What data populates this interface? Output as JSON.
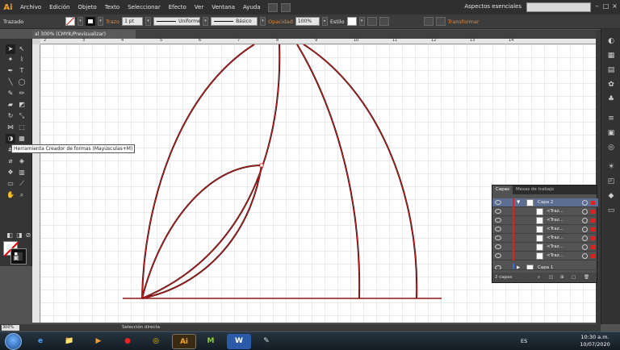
{
  "menubar": {
    "logo": "Ai",
    "items": [
      "Archivo",
      "Edición",
      "Objeto",
      "Texto",
      "Seleccionar",
      "Efecto",
      "Ver",
      "Ventana",
      "Ayuda"
    ],
    "workspace": "Aspectos esenciales",
    "window_buttons": [
      "–",
      "□",
      "×"
    ]
  },
  "controlbar": {
    "selection_label": "Trazado",
    "stroke_label": "Trazo",
    "stroke_weight": "1 pt",
    "stroke_profile": "Uniforme",
    "brush": "Básico",
    "opacity_label": "Opacidad",
    "opacity_value": "100%",
    "style_label": "Estilo",
    "transform_label": "Transformar"
  },
  "document": {
    "tab_title": "al 300% (CMYK/Previsualizar)"
  },
  "ruler": {
    "top_ticks": [
      "2",
      "3",
      "4",
      "5",
      "6",
      "7",
      "8",
      "9",
      "10",
      "11",
      "12",
      "13",
      "14"
    ]
  },
  "tooltip": "Herramienta Creador de formas (Mayúsculas+M)",
  "layers_panel": {
    "tabs": [
      "Capas",
      "Mesas de trabajo"
    ],
    "rows": [
      {
        "label": "Capa 2",
        "type": "layer"
      },
      {
        "label": "<Traz...",
        "type": "path"
      },
      {
        "label": "<Traz...",
        "type": "path"
      },
      {
        "label": "<Traz...",
        "type": "path"
      },
      {
        "label": "<Traz...",
        "type": "path"
      },
      {
        "label": "<Traz...",
        "type": "path"
      },
      {
        "label": "<Traz...",
        "type": "path"
      },
      {
        "label": "Capa 1",
        "type": "layer"
      }
    ],
    "footer": "2 capas"
  },
  "statusbar": {
    "zoom": "300%",
    "tool": "Selección directa"
  },
  "taskbar": {
    "language": "ES",
    "time": "10:30 a.m.",
    "date": "10/07/2020",
    "apps": [
      "e",
      "📁",
      "▶",
      "●",
      "◎",
      "Ai",
      "M",
      "W",
      "✎"
    ]
  },
  "colors": {
    "accent_orange": "#f7a21b",
    "selection_red": "#dd2222",
    "layer_selected": "#5c6f93"
  }
}
